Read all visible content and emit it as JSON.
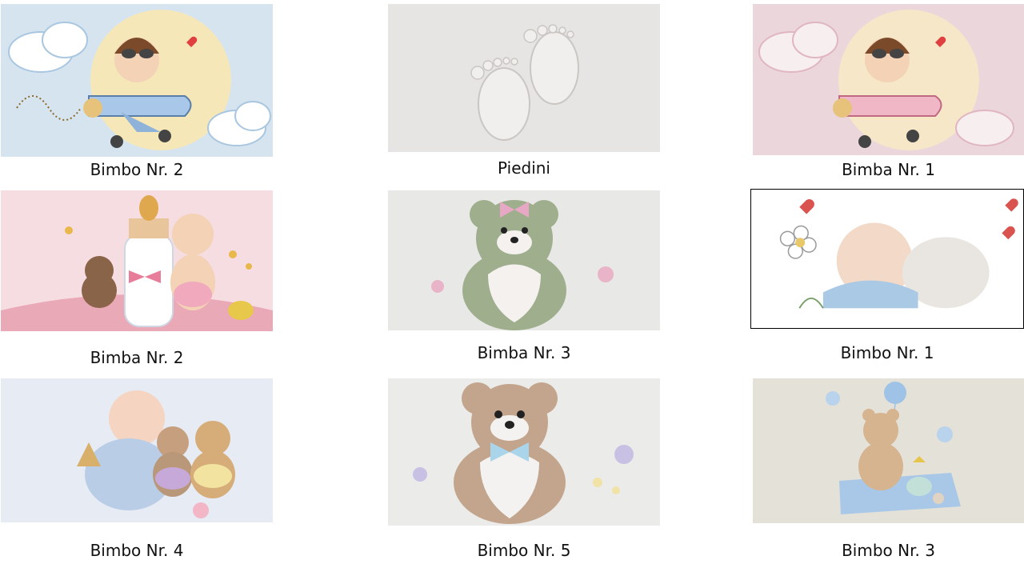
{
  "cards": [
    {
      "id": "bimbo-nr-2",
      "label": "Bimbo Nr. 2",
      "accent": "#b7d3ea"
    },
    {
      "id": "piedini",
      "label": "Piedini",
      "accent": "#e6e4e2"
    },
    {
      "id": "bimba-nr-1",
      "label": "Bimba Nr. 1",
      "accent": "#e9c8d1"
    },
    {
      "id": "bimba-nr-2",
      "label": "Bimba Nr. 2",
      "accent": "#f2cfd6"
    },
    {
      "id": "bimba-nr-3",
      "label": "Bimba Nr. 3",
      "accent": "#9fae8c"
    },
    {
      "id": "bimbo-nr-1",
      "label": "Bimbo Nr. 1",
      "accent": "#a9c9e4"
    },
    {
      "id": "bimbo-nr-4",
      "label": "Bimbo Nr. 4",
      "accent": "#d6dff0"
    },
    {
      "id": "bimbo-nr-5",
      "label": "Bimbo Nr. 5",
      "accent": "#c2a58c"
    },
    {
      "id": "bimbo-nr-3",
      "label": "Bimbo Nr. 3",
      "accent": "#9ec3e6"
    }
  ]
}
